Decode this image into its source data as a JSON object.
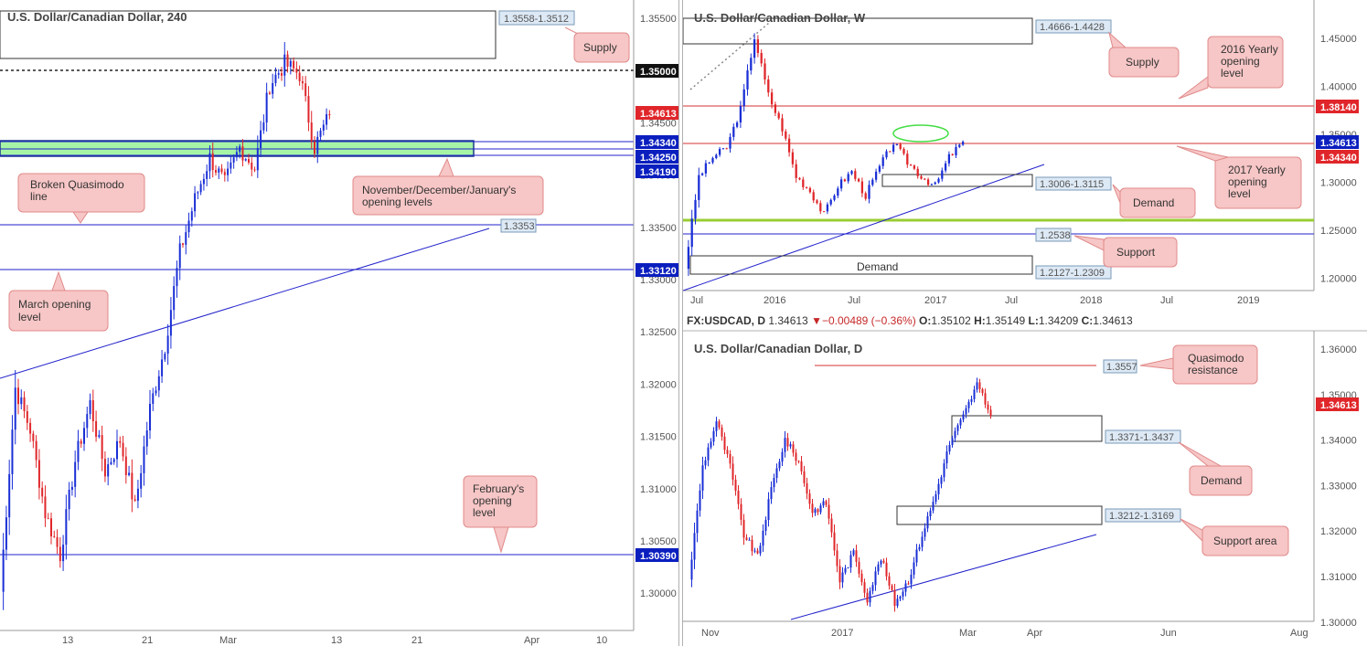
{
  "colors": {
    "bull": "#1a2fd6",
    "bear": "#e0262a",
    "green_zone": "#a6f5a6",
    "blue_line": "#2222cc",
    "red_line": "#d43333",
    "callout_fill": "#f7c6c6",
    "callout_stroke": "#e08a8a",
    "price_box_blue": "#0b1fbf",
    "price_box_red": "#e0262a",
    "green_band": "#99cc33"
  },
  "h4": {
    "title": "U.S. Dollar/Canadian Dollar, 240",
    "y_ticks": [
      "1.35500",
      "1.35000",
      "1.34500",
      "1.34000",
      "1.33500",
      "1.33000",
      "1.32500",
      "1.32000",
      "1.31500",
      "1.31000",
      "1.30500",
      "1.30000"
    ],
    "x_ticks": [
      "13",
      "21",
      "Mar",
      "13",
      "21",
      "Apr",
      "10"
    ],
    "labels": {
      "supply_box": "1.3558-1.3512",
      "supply": "Supply",
      "broken_qm": "Broken Quasimodo line",
      "ndj": "November/December/January's opening levels",
      "march": "March opening level",
      "feb": "February's opening level",
      "p_1_3353": "1.3353"
    },
    "price_boxes": {
      "p1": "1.35000",
      "p2": "1.34613",
      "p3": "1.34340",
      "p4": "1.34250",
      "p5": "1.34190",
      "p6": "1.33120",
      "p7": "1.30390"
    }
  },
  "weekly": {
    "title": "U.S. Dollar/Canadian Dollar, W",
    "y_ticks": [
      "1.45000",
      "1.40000",
      "1.35000",
      "1.30000",
      "1.25000",
      "1.20000"
    ],
    "x_ticks": [
      "Jul",
      "2016",
      "Jul",
      "2017",
      "Jul",
      "2018",
      "Jul",
      "2019"
    ],
    "labels": {
      "supply_box": "1.4666-1.4428",
      "supply": "Supply",
      "y2016": "2016 Yearly opening level",
      "y2017": "2017 Yearly opening level",
      "demand_box": "1.3006-1.3115",
      "demand": "Demand",
      "support_val": "1.2538",
      "support": "Support",
      "demand2": "Demand",
      "demand2_box": "1.2127-1.2309"
    },
    "price_boxes": {
      "p1": "1.38140",
      "p2": "1.34613",
      "p3": "1.34340"
    }
  },
  "daily": {
    "header": {
      "symbol": "FX:USDCAD, D",
      "last": "1.34613",
      "change": "▼−0.00489 (−0.36%)",
      "o_label": "O:",
      "o": "1.35102",
      "h_label": "H:",
      "h": "1.35149",
      "l_label": "L:",
      "l": "1.34209",
      "c_label": "C:",
      "c": "1.34613"
    },
    "title": "U.S. Dollar/Canadian Dollar, D",
    "y_ticks": [
      "1.36000",
      "1.35000",
      "1.34000",
      "1.33000",
      "1.32000",
      "1.31000",
      "1.30000"
    ],
    "x_ticks": [
      "Nov",
      "2017",
      "Mar",
      "Apr",
      "Jun",
      "Aug"
    ],
    "labels": {
      "qm_val": "1.3557",
      "qm": "Quasimodo resistance",
      "demand_box": "1.3371-1.3437",
      "demand": "Demand",
      "support_box": "1.3212-1.3169",
      "support": "Support area"
    },
    "price_boxes": {
      "p1": "1.34613"
    }
  },
  "chart_data": [
    {
      "type": "candlestick",
      "title": "U.S. Dollar/Canadian Dollar, 240",
      "ylim": [
        1.2975,
        1.357
      ],
      "levels": [
        1.35,
        1.3434,
        1.3425,
        1.3419,
        1.3353,
        1.3312,
        1.3039
      ],
      "zones": [
        {
          "name": "Supply",
          "from": 1.3512,
          "to": 1.3558
        },
        {
          "name": "November/December/January's opening levels",
          "from": 1.3419,
          "to": 1.3434
        }
      ],
      "last": 1.34613
    },
    {
      "type": "candlestick",
      "title": "U.S. Dollar/Canadian Dollar, W",
      "ylim": [
        1.195,
        1.475
      ],
      "levels": [
        1.3814,
        1.3434,
        1.2538
      ],
      "zones": [
        {
          "name": "Supply",
          "from": 1.4428,
          "to": 1.4666
        },
        {
          "name": "Demand",
          "from": 1.3006,
          "to": 1.3115
        },
        {
          "name": "Demand",
          "from": 1.2127,
          "to": 1.2309
        }
      ],
      "last": 1.34613
    },
    {
      "type": "candlestick",
      "title": "U.S. Dollar/Canadian Dollar, D",
      "ylim": [
        1.295,
        1.364
      ],
      "levels": [
        1.3557
      ],
      "zones": [
        {
          "name": "Demand",
          "from": 1.3371,
          "to": 1.3437
        },
        {
          "name": "Support area",
          "from": 1.3169,
          "to": 1.3212
        }
      ],
      "ohlc_last": {
        "o": 1.35102,
        "h": 1.35149,
        "l": 1.34209,
        "c": 1.34613
      }
    }
  ]
}
